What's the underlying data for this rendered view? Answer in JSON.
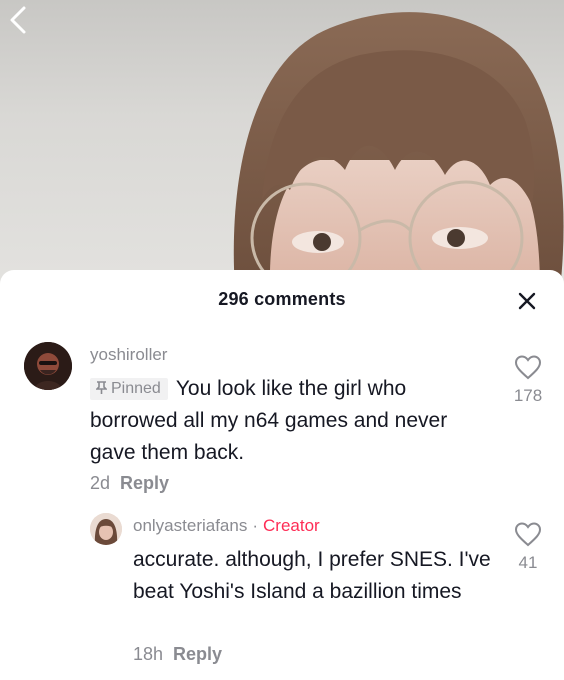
{
  "header": {
    "comment_count": "296 comments"
  },
  "icons": {
    "back": "chevron-left-icon",
    "close": "close-icon",
    "like": "heart-outline-icon",
    "pin": "pin-icon"
  },
  "colors": {
    "creator_accent": "#fe2c55",
    "secondary_text": "#8a8b91",
    "primary_text": "#161823"
  },
  "comments": [
    {
      "username": "yoshiroller",
      "pinned_label": "Pinned",
      "text": "You look like the girl who borrowed all my n64 games and never gave them back.",
      "age": "2d",
      "reply_label": "Reply",
      "likes": "178",
      "replies": [
        {
          "username": "onlyasteriafans",
          "separator": "·",
          "badge": "Creator",
          "text": "accurate. although, I prefer SNES. I've beat Yoshi's Island a bazillion times",
          "age": "18h",
          "reply_label": "Reply",
          "likes": "41"
        }
      ]
    }
  ]
}
